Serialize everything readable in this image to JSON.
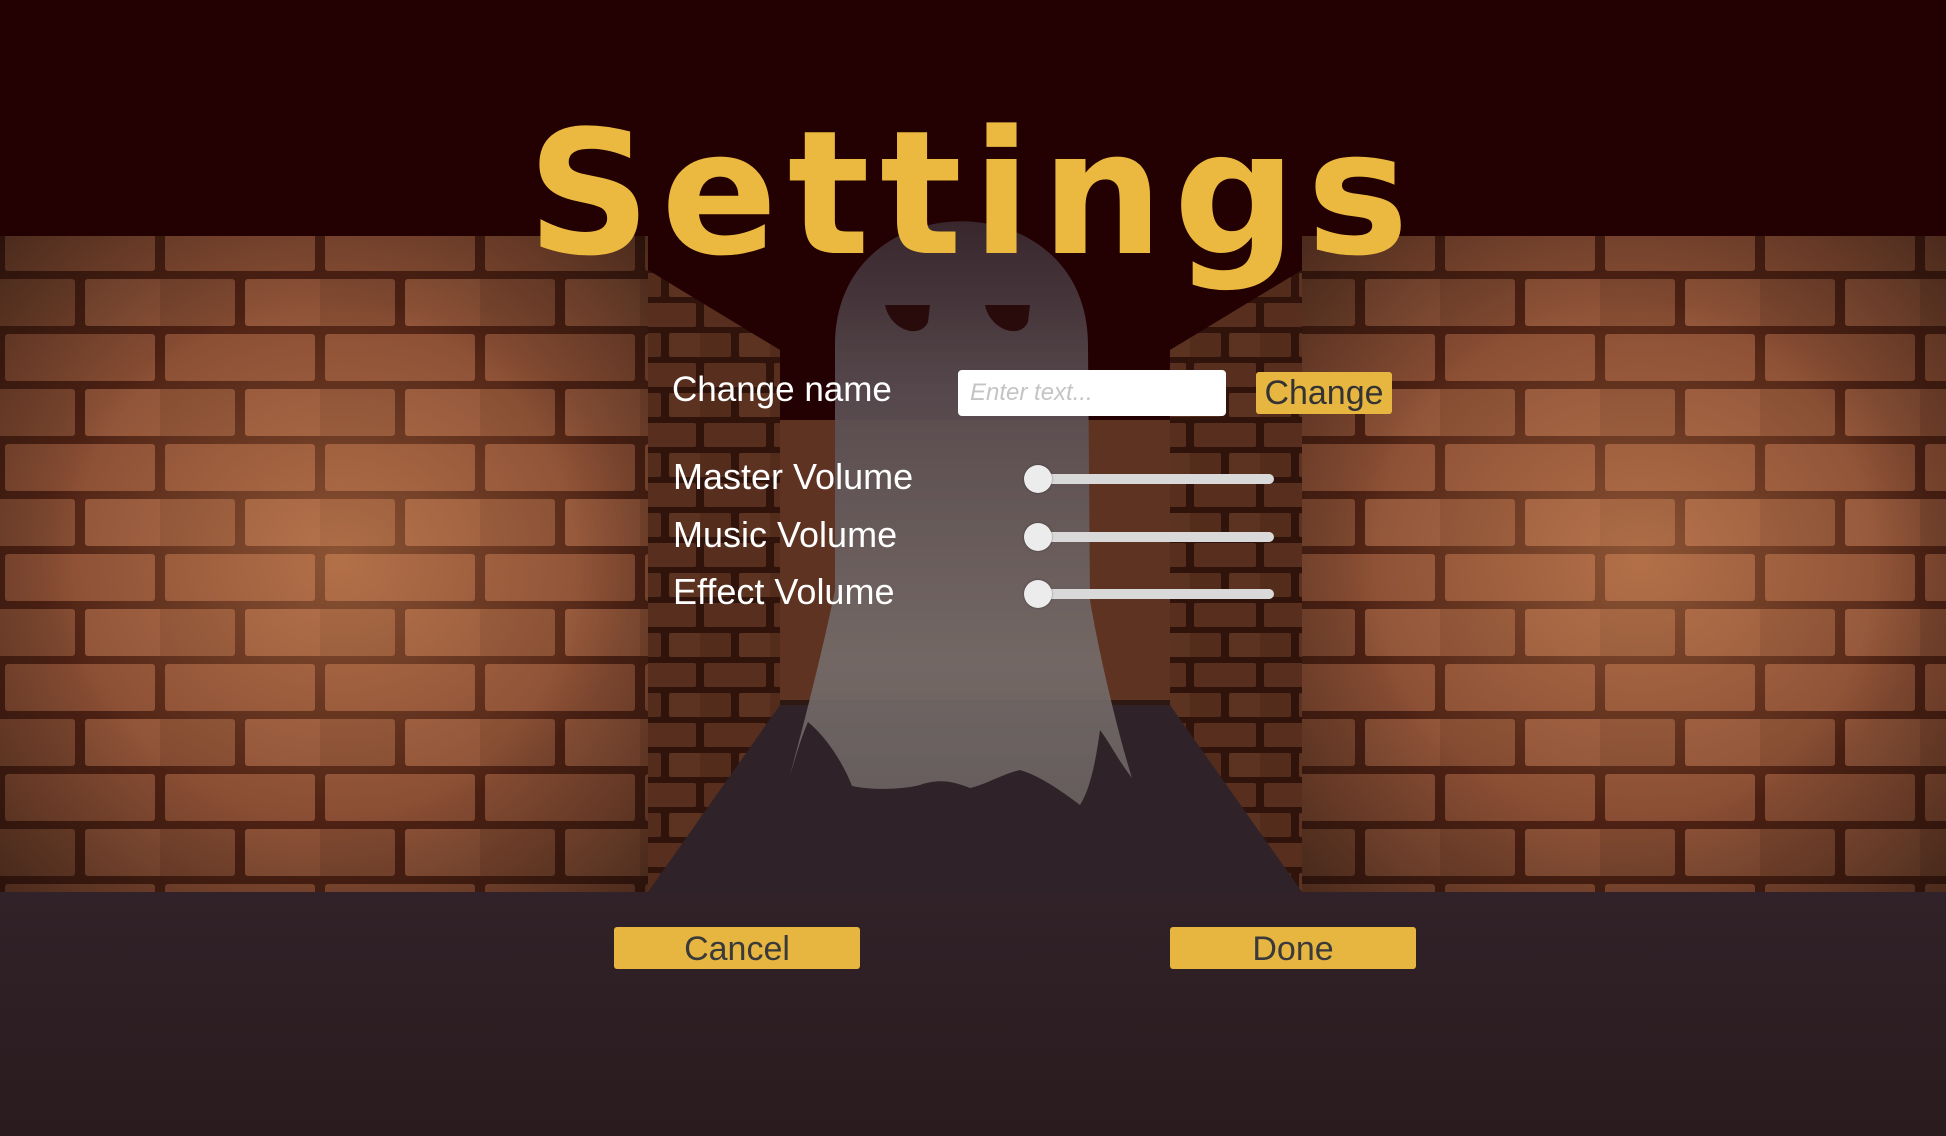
{
  "screen": {
    "title": "Settings",
    "colors": {
      "title": "#ebb93f",
      "button": "#e6b640",
      "sky": "#230002",
      "floor": "#2d1d21",
      "brick": "#8a4e34"
    }
  },
  "name_row": {
    "label": "Change name",
    "input_placeholder": "Enter text...",
    "input_value": "",
    "button_label": "Change"
  },
  "volume": {
    "sliders": [
      {
        "key": "master",
        "label": "Master Volume",
        "value": 0
      },
      {
        "key": "music",
        "label": "Music Volume",
        "value": 0
      },
      {
        "key": "effect",
        "label": "Effect Volume",
        "value": 0
      }
    ]
  },
  "actions": {
    "cancel_label": "Cancel",
    "done_label": "Done"
  },
  "icons": {
    "background": "ghost-in-brick-corridor"
  }
}
